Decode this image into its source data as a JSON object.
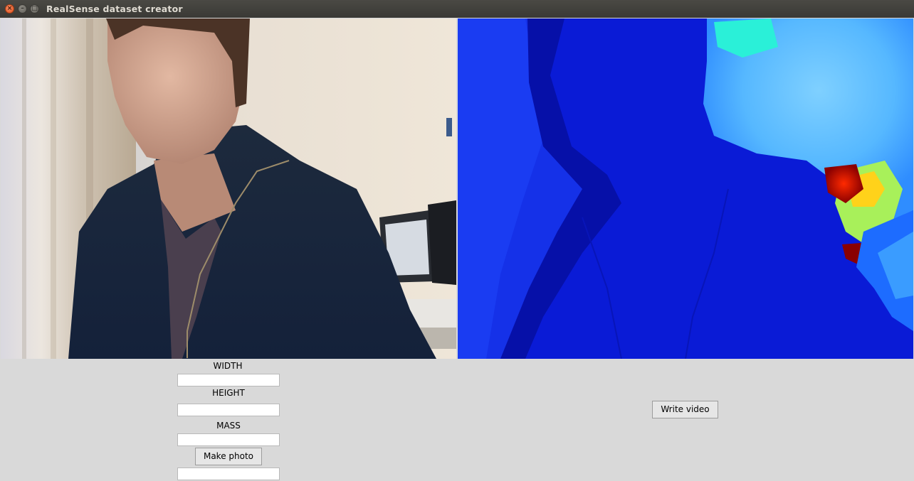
{
  "window": {
    "title": "RealSense dataset creator",
    "controls": [
      {
        "name": "close-icon",
        "glyph": "×"
      },
      {
        "name": "minimize-icon",
        "glyph": "–"
      },
      {
        "name": "maximize-icon",
        "glyph": "□"
      }
    ]
  },
  "views": {
    "rgb": {
      "description_icon": "camera-feed"
    },
    "depth": {
      "colormap": "jet",
      "colors": {
        "far": "#0a10c8",
        "mid": "#2f8dff",
        "near": "#ffe21a",
        "nearest": "#8a0000"
      }
    }
  },
  "form": {
    "width_label": "WIDTH",
    "width_value": "",
    "height_label": "HEIGHT",
    "height_value": "",
    "mass_label": "MASS",
    "mass_value": "",
    "make_photo_label": "Make photo",
    "result_value": ""
  },
  "actions": {
    "write_video_label": "Write video"
  }
}
